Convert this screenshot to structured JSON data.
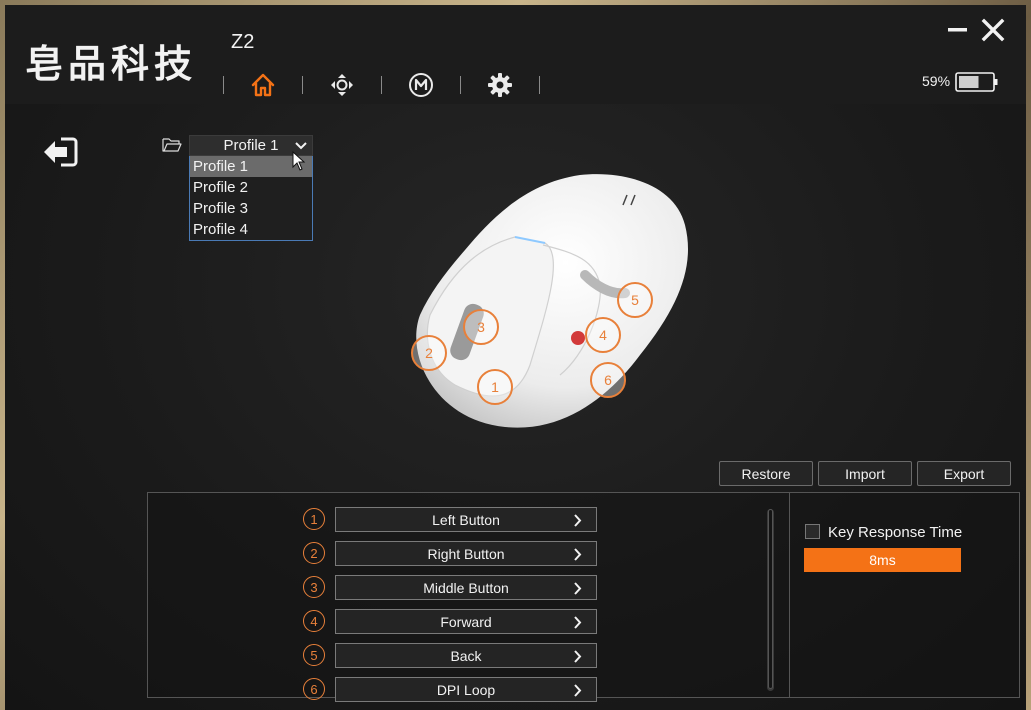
{
  "app": {
    "logo_text": "皂品科技",
    "model": "Z2",
    "battery_percent": "59%",
    "battery_level": 0.59
  },
  "nav": {
    "items": [
      {
        "icon": "home-icon",
        "active": true
      },
      {
        "icon": "move-arrows-icon",
        "active": false
      },
      {
        "icon": "macro-m-icon",
        "active": false
      },
      {
        "icon": "gear-icon",
        "active": false
      }
    ]
  },
  "profile": {
    "selected": "Profile 1",
    "options": [
      "Profile 1",
      "Profile 2",
      "Profile 3",
      "Profile 4"
    ]
  },
  "mouse_markers": [
    "1",
    "2",
    "3",
    "4",
    "5",
    "6"
  ],
  "actions": {
    "restore": "Restore",
    "import": "Import",
    "export": "Export"
  },
  "buttons": [
    {
      "number": "1",
      "label": "Left Button"
    },
    {
      "number": "2",
      "label": "Right Button"
    },
    {
      "number": "3",
      "label": "Middle Button"
    },
    {
      "number": "4",
      "label": "Forward"
    },
    {
      "number": "5",
      "label": "Back"
    },
    {
      "number": "6",
      "label": "DPI Loop"
    }
  ],
  "key_response": {
    "label": "Key Response Time",
    "value": "8ms",
    "checked": false
  },
  "colors": {
    "accent": "#f47216",
    "badge": "#e8803a"
  }
}
